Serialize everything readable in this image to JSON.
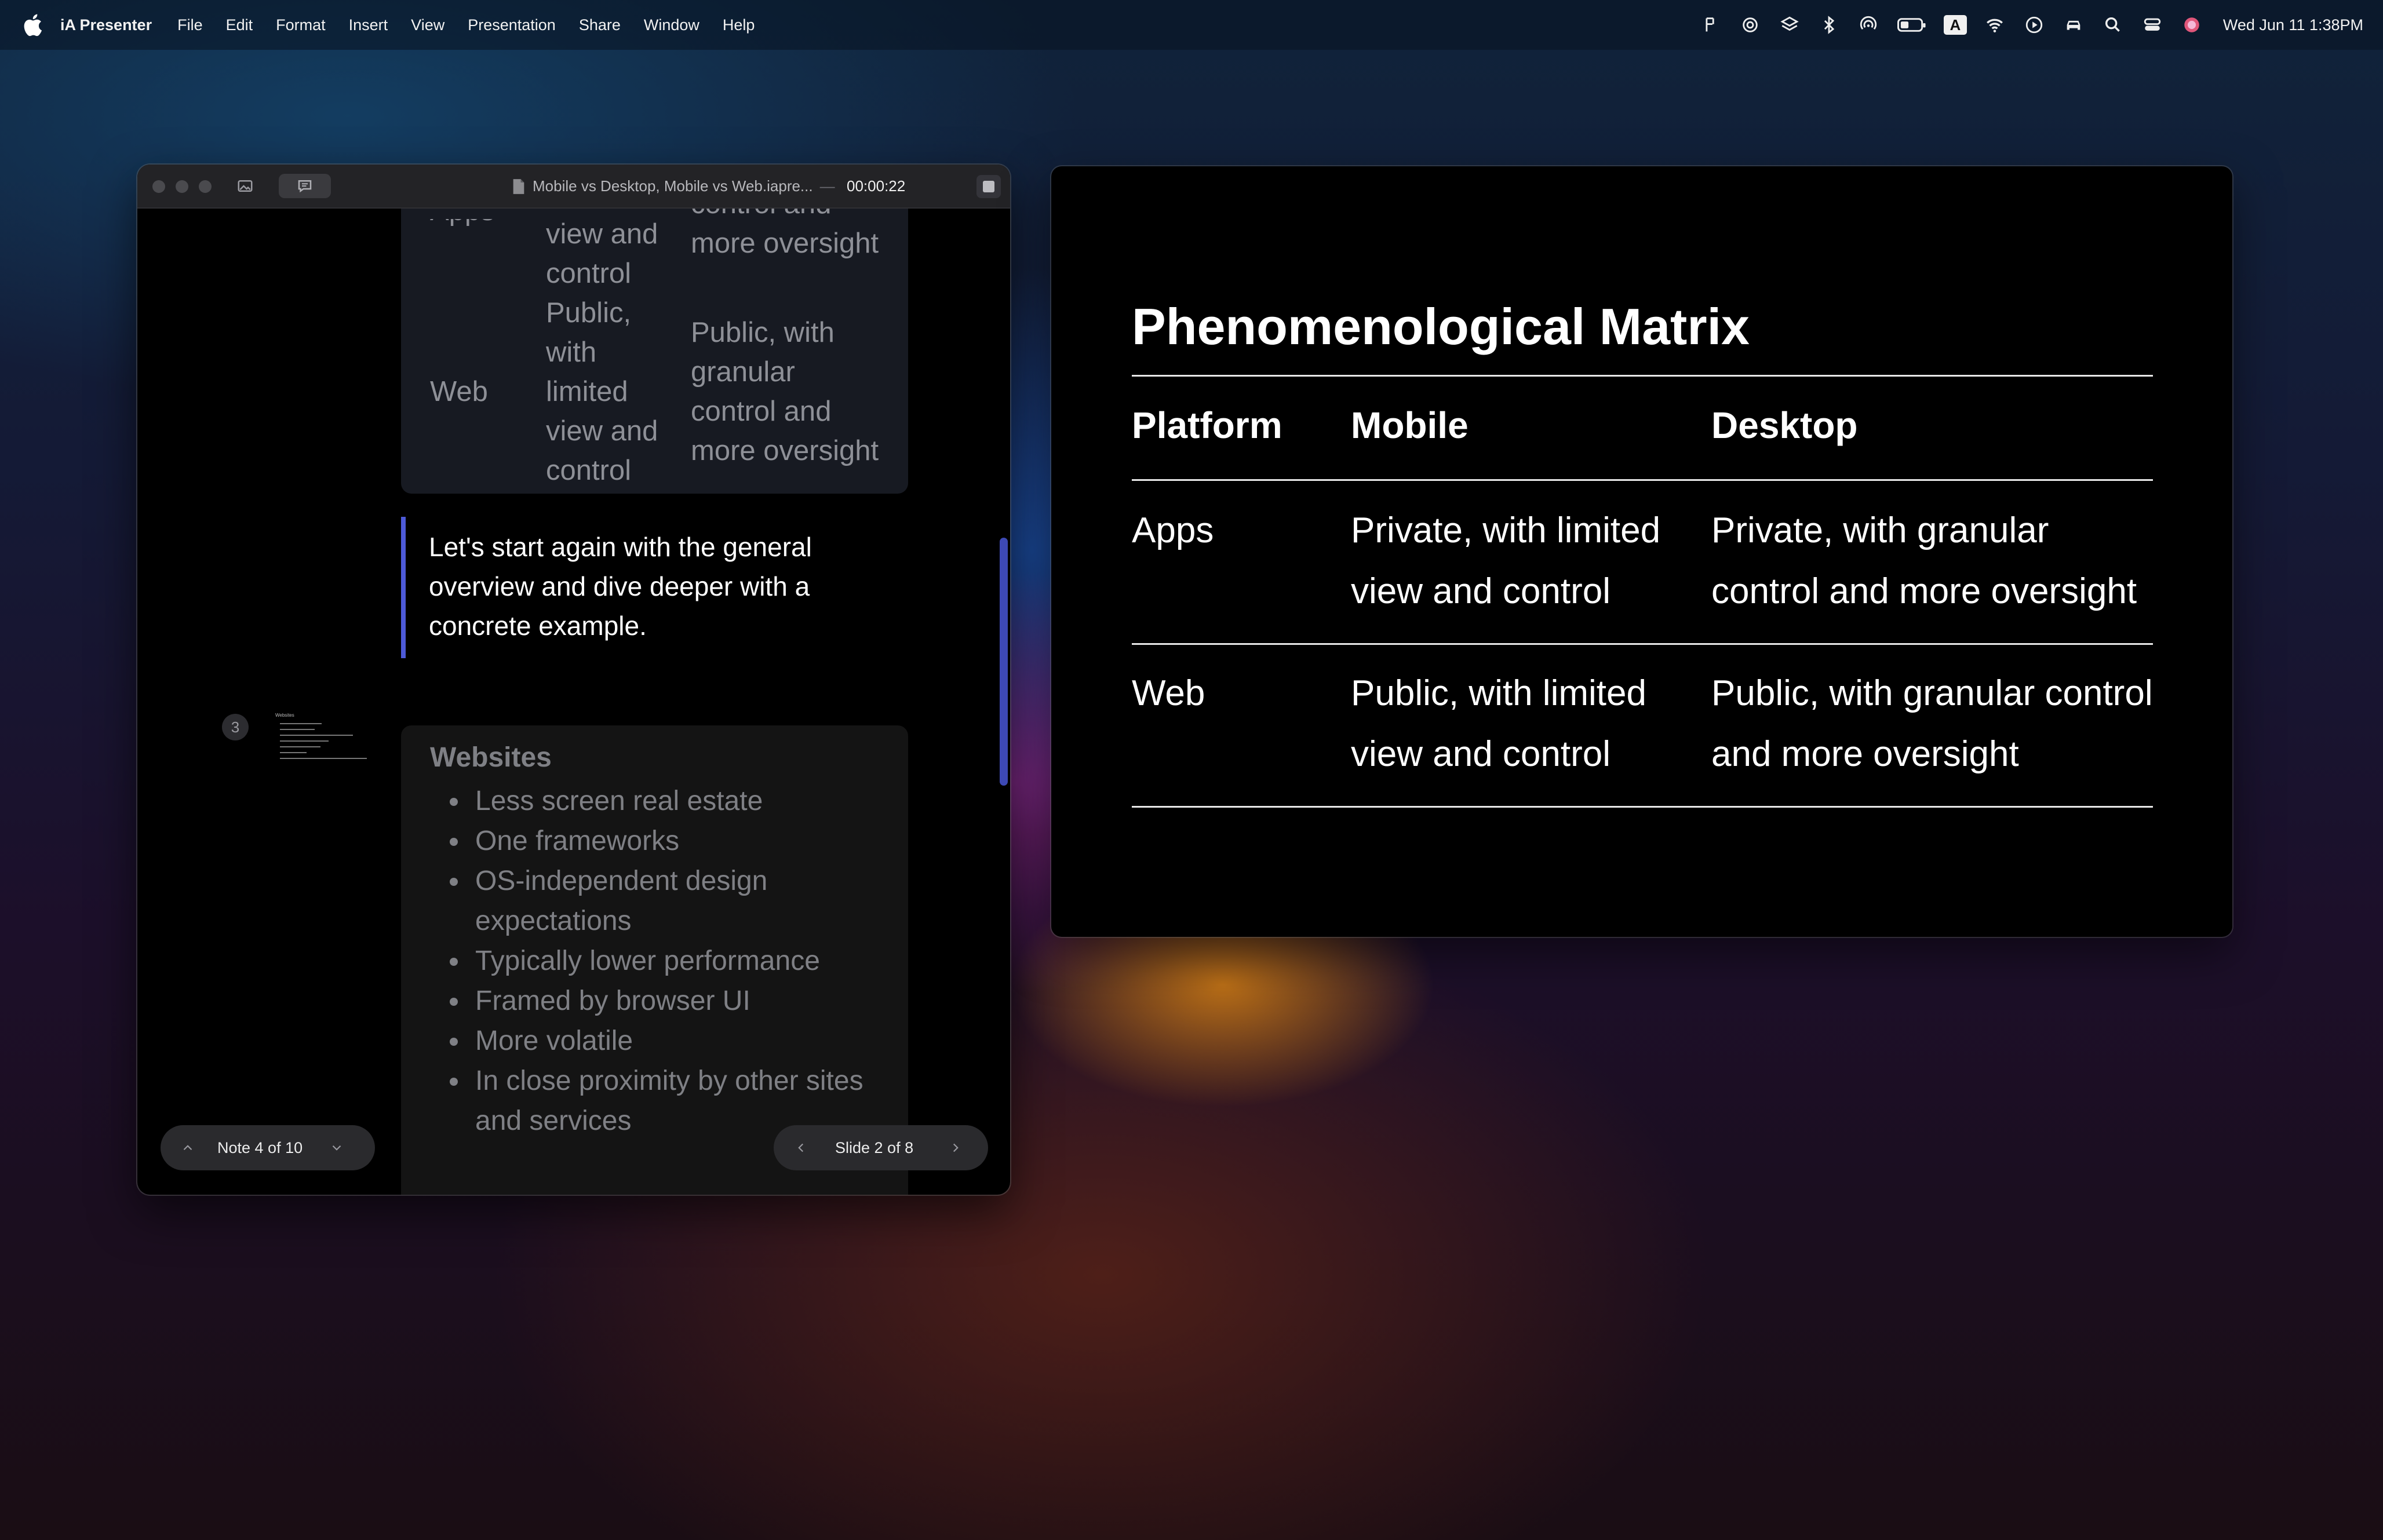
{
  "menubar": {
    "app_name": "iA Presenter",
    "items": [
      "File",
      "Edit",
      "Format",
      "Insert",
      "View",
      "Presentation",
      "Share",
      "Window",
      "Help"
    ],
    "status_icons": [
      "fork-icon",
      "openai-icon",
      "layers-icon",
      "bluetooth-icon",
      "airdrop-icon",
      "battery-icon",
      "input-source-icon",
      "wifi-icon",
      "play-icon",
      "car-icon",
      "search-icon",
      "control-center-icon",
      "siri-icon"
    ],
    "input_source_label": "A",
    "clock": "Wed Jun 11  1:38PM"
  },
  "presenter": {
    "doc_title": "Mobile vs Desktop, Mobile vs Web.iapre...",
    "title_separator": "—",
    "timer": "00:00:22",
    "table": {
      "col1_fragment": "Apps",
      "row1_mobile_fragment": [
        "view and",
        "control"
      ],
      "row1_desktop_fragment": [
        "control and",
        "more oversight"
      ],
      "row2_platform": "Web",
      "row2_mobile": [
        "Public,",
        "with",
        "limited",
        "view and",
        "control"
      ],
      "row2_desktop": [
        "Public, with",
        "granular",
        "control and",
        "more oversight"
      ]
    },
    "note_text": "Let's start again with the general overview and dive deeper with a concrete example.",
    "slide3": {
      "number": "3",
      "heading": "Websites",
      "bullets": [
        "Less screen real estate",
        "One frameworks",
        "OS-independent design expectations",
        "Typically lower performance",
        "Framed by browser UI",
        "More volatile",
        "In close proximity by other sites and services"
      ]
    },
    "note_nav": "Note 4 of 10",
    "slide_nav": "Slide 2 of 8"
  },
  "slide": {
    "title": "Phenomenological Matrix",
    "headers": [
      "Platform",
      "Mobile",
      "Desktop"
    ],
    "rows": [
      {
        "platform": "Apps",
        "mobile": [
          "Private, with limited",
          "view and control"
        ],
        "desktop": [
          "Private, with granular",
          "control and more oversight"
        ]
      },
      {
        "platform": "Web",
        "mobile": [
          "Public, with limited",
          "view and control"
        ],
        "desktop": [
          "Public, with granular control",
          "and more oversight"
        ]
      }
    ]
  },
  "colors": {
    "accent": "#4d5ad8",
    "slide_background": "#000000",
    "card_background": "#171a22"
  }
}
